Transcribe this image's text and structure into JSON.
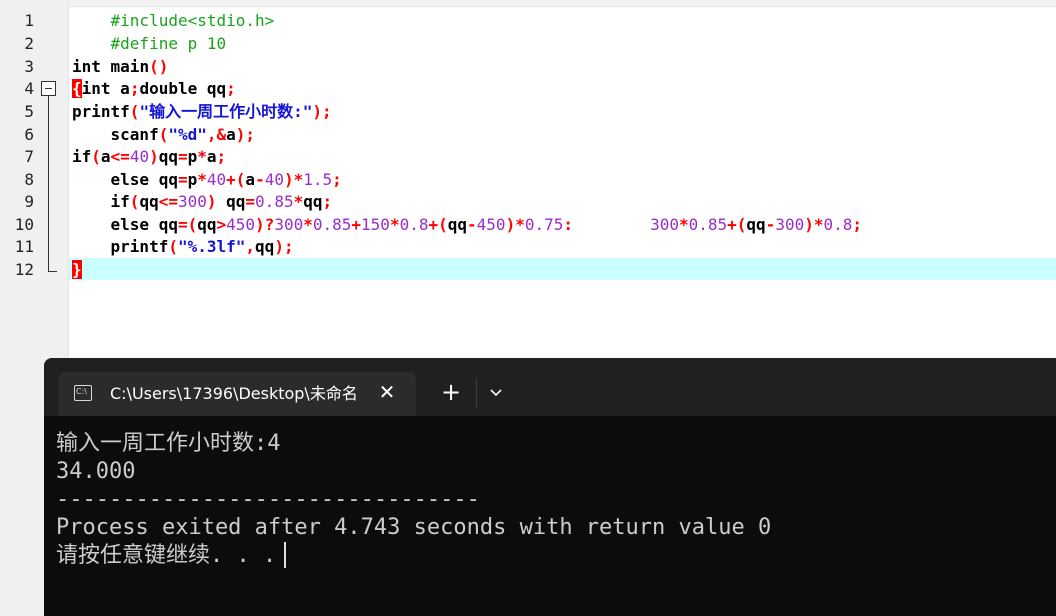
{
  "editor": {
    "line_numbers": [
      "1",
      "2",
      "3",
      "4",
      "5",
      "6",
      "7",
      "8",
      "9",
      "10",
      "11",
      "12"
    ],
    "lines": {
      "l1": "    #include<stdio.h>",
      "l2": "    #define p 10",
      "l3_kw": "int",
      "l3_rest": " main",
      "l3_par": "()",
      "l4_brace": "{",
      "l4_a": "int a",
      "l4_semi1": ";",
      "l4_b": "double qq",
      "l4_semi2": ";",
      "l5_fn": "printf",
      "l5_p1": "(",
      "l5_str": "\"输入一周工作小时数:\"",
      "l5_p2": ");",
      "l6_a": "    scanf",
      "l6_p1": "(",
      "l6_str": "\"%d\"",
      "l6_c": ",&",
      "l6_v": "a",
      "l6_p2": ");",
      "l7_a": "if",
      "l7_b": "(",
      "l7_c": "a",
      "l7_d": "<=",
      "l7_e": "40",
      "l7_f": ")",
      "l7_g": "qq",
      "l7_h": "=",
      "l7_i": "p",
      "l7_j": "*",
      "l7_k": "a",
      "l7_l": ";",
      "l8_a": "    else qq",
      "l8_b": "=",
      "l8_c": "p",
      "l8_d": "*",
      "l8_e": "40",
      "l8_f": "+(",
      "l8_g": "a",
      "l8_h": "-",
      "l8_i": "40",
      "l8_j": ")*",
      "l8_k": "1.5",
      "l8_l": ";",
      "l9_a": "    if",
      "l9_b": "(",
      "l9_c": "qq",
      "l9_d": "<=",
      "l9_e": "300",
      "l9_f": ") ",
      "l9_g": "qq",
      "l9_h": "=",
      "l9_i": "0.85",
      "l9_j": "*",
      "l9_k": "qq",
      "l9_l": ";",
      "l10_a": "    else qq",
      "l10_b": "=(",
      "l10_c": "qq",
      "l10_d": ">",
      "l10_e": "450",
      "l10_f": ")?",
      "l10_g": "300",
      "l10_h": "*",
      "l10_i": "0.85",
      "l10_j": "+",
      "l10_k": "150",
      "l10_l": "*",
      "l10_m": "0.8",
      "l10_n": "+(",
      "l10_o": "qq",
      "l10_p": "-",
      "l10_q": "450",
      "l10_r": ")*",
      "l10_s": "0.75",
      "l10_t": ":        ",
      "l10_u": "300",
      "l10_v": "*",
      "l10_w": "0.85",
      "l10_x": "+(",
      "l10_y": "qq",
      "l10_z": "-",
      "l10_aa": "300",
      "l10_ab": ")*",
      "l10_ac": "0.8",
      "l10_ad": ";",
      "l11_a": "    printf",
      "l11_b": "(",
      "l11_c": "\"%.3lf\"",
      "l11_d": ",",
      "l11_e": "qq",
      "l11_f": ");",
      "l12_brace": "}"
    }
  },
  "terminal": {
    "tab_title": "C:\\Users\\17396\\Desktop\\未命名",
    "close_glyph": "✕",
    "new_tab_glyph": "+",
    "output": [
      "输入一周工作小时数:4",
      "34.000",
      "--------------------------------",
      "Process exited after 4.743 seconds with return value 0",
      "请按任意键继续. . ."
    ]
  },
  "colors": {
    "keyword": "#000000",
    "operator": "#ff0000",
    "number": "#9b2dcc",
    "string": "#1414d6",
    "preprocessor": "#1aa31a",
    "current_line": "#ccffff",
    "terminal_bg": "#0c0c0c"
  }
}
